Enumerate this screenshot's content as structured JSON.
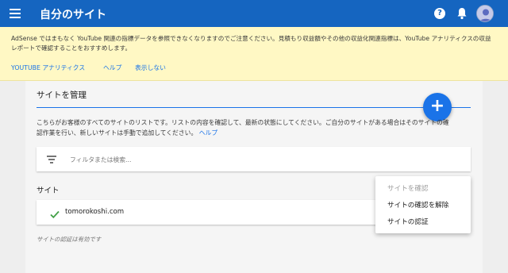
{
  "header": {
    "title": "自分のサイト",
    "help_glyph": "?"
  },
  "banner": {
    "text": "AdSense ではまもなく YouTube 関連の指標データを参照できなくなりますのでご注意ください。見積もり収益額やその他の収益化関連指標は、YouTube アナリティクスの収益レポートで確認することをおすすめします。",
    "links": [
      "YOUTUBE アナリティクス",
      "ヘルプ",
      "表示しない"
    ]
  },
  "manage": {
    "title": "サイトを管理",
    "add_glyph": "+",
    "description": "こちらがお客様のすべてのサイトのリストです。リストの内容を確認して、最新の状態にしてください。ご自分のサイトがある場合はそのサイトの確認作業を行い、新しいサイトは手動で追加してください。",
    "help_link": "ヘルプ"
  },
  "filter": {
    "placeholder": "フィルタまたは検索..."
  },
  "sites": {
    "label": "サイト",
    "rows": [
      {
        "name": "tomorokoshi.com",
        "verified": true
      }
    ],
    "status": "サイトの認証は有効です"
  },
  "context_menu": {
    "items": [
      {
        "label": "サイトを確認",
        "disabled": true
      },
      {
        "label": "サイトの確認を解除",
        "disabled": false
      },
      {
        "label": "サイトの認証",
        "disabled": false
      }
    ]
  },
  "colors": {
    "header_bg": "#1565c0",
    "banner_bg": "#fff8c4",
    "accent": "#1a73e8",
    "check": "#43a047"
  }
}
